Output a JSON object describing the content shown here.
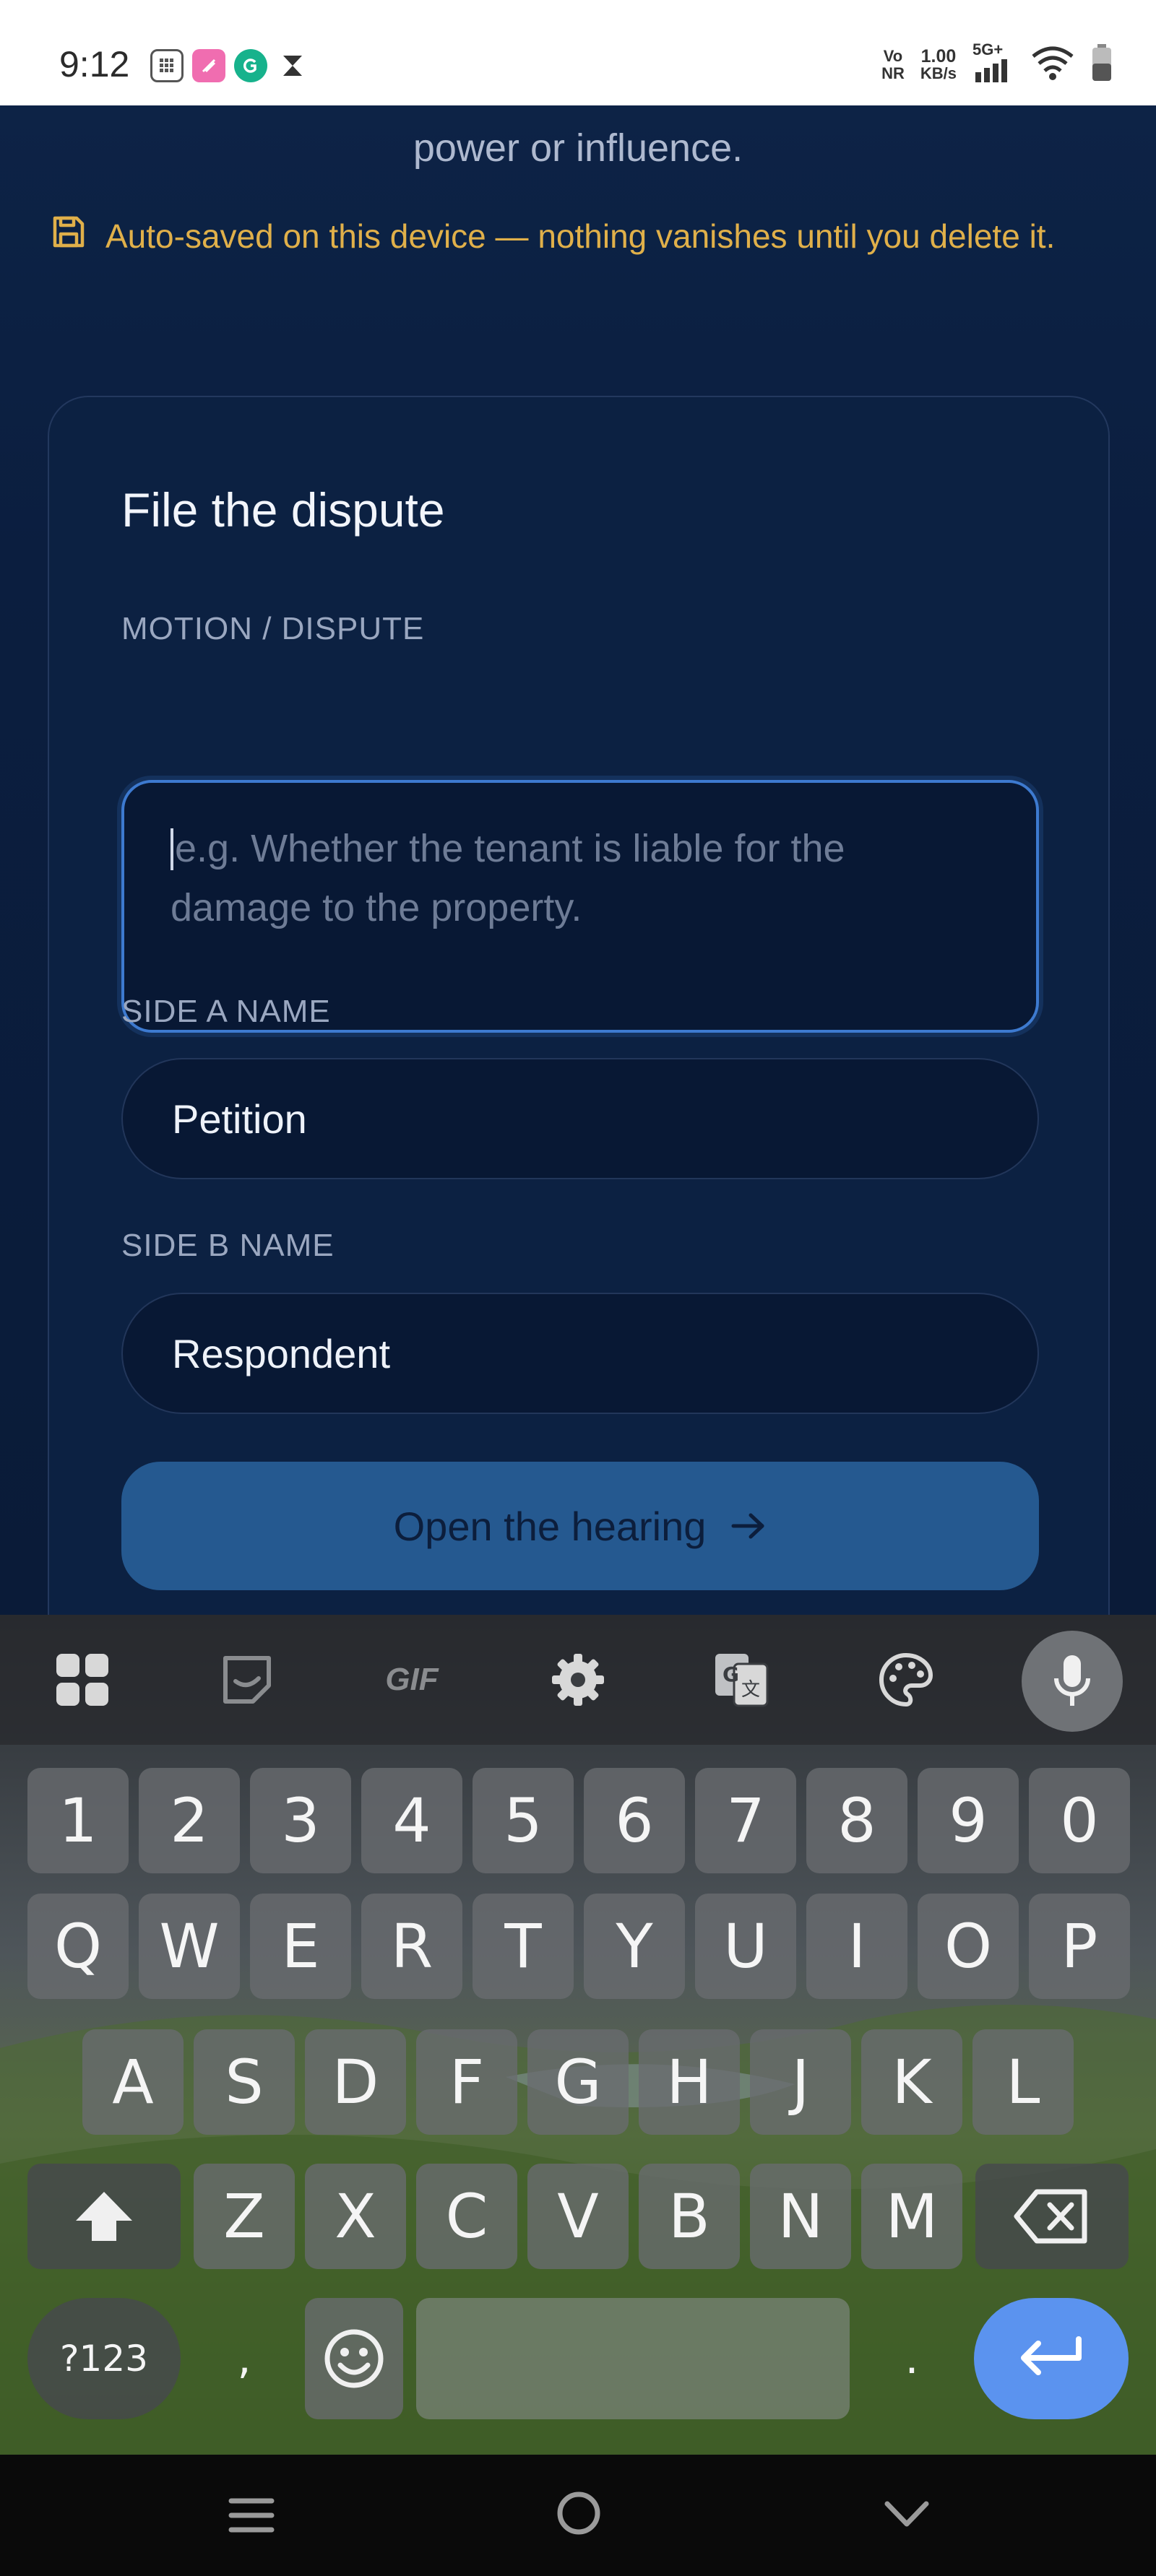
{
  "status_bar": {
    "time": "9:12",
    "volte_top": "Vo",
    "volte_bottom": "NR",
    "speed_top": "1.00",
    "speed_bottom": "KB/s",
    "network": "5G+"
  },
  "app": {
    "intro_tail": "power or influence.",
    "autosave_text": "Auto-saved on this device — nothing vanishes until you delete it.",
    "form": {
      "title": "File the dispute",
      "motion_label": "MOTION / DISPUTE",
      "motion_placeholder": "e.g. Whether the tenant is liable for the damage to the property.",
      "side_a_label": "SIDE A NAME",
      "side_a_value": "Petition",
      "side_b_label": "SIDE B NAME",
      "side_b_value": "Respondent",
      "submit_label": "Open the hearing"
    }
  },
  "keyboard": {
    "toolbar": [
      "apps-icon",
      "sticker-icon",
      "gif-icon",
      "settings-icon",
      "translate-icon",
      "theme-icon",
      "mic-icon"
    ],
    "gif_label": "GIF",
    "row_numbers": [
      "1",
      "2",
      "3",
      "4",
      "5",
      "6",
      "7",
      "8",
      "9",
      "0"
    ],
    "row_1": [
      "Q",
      "W",
      "E",
      "R",
      "T",
      "Y",
      "U",
      "I",
      "O",
      "P"
    ],
    "row_2": [
      "A",
      "S",
      "D",
      "F",
      "G",
      "H",
      "J",
      "K",
      "L"
    ],
    "row_3": [
      "Z",
      "X",
      "C",
      "V",
      "B",
      "N",
      "M"
    ],
    "symbols_label": "?123",
    "comma": ",",
    "period": "."
  },
  "colors": {
    "accent": "#3d7ad0",
    "autosave": "#e0b04a",
    "button": "#255990",
    "enter": "#5b93ef"
  }
}
